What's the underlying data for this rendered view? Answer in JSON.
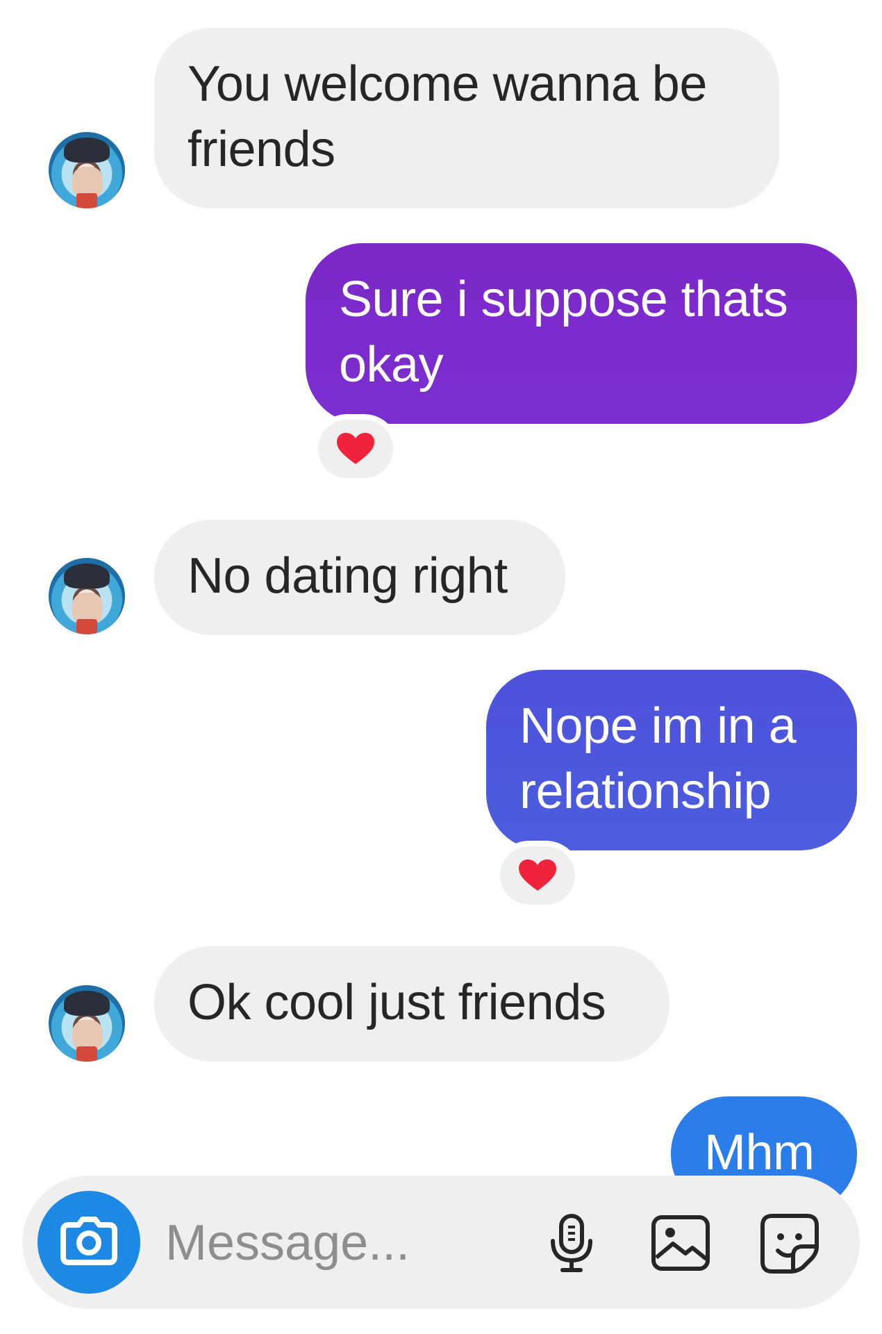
{
  "messages": [
    {
      "id": "m1",
      "direction": "incoming",
      "text": "You welcome wanna be friends"
    },
    {
      "id": "m2",
      "direction": "outgoing",
      "text": "Sure i suppose thats okay",
      "reaction": "heart"
    },
    {
      "id": "m3",
      "direction": "incoming",
      "text": "No dating right"
    },
    {
      "id": "m4",
      "direction": "outgoing",
      "text": "Nope im in a relationship",
      "reaction": "heart"
    },
    {
      "id": "m5",
      "direction": "incoming",
      "text": "Ok cool just friends"
    },
    {
      "id": "m6",
      "direction": "outgoing",
      "text": "Mhm"
    }
  ],
  "composer": {
    "placeholder": "Message...",
    "icons": [
      "camera-icon",
      "microphone-icon",
      "image-icon",
      "sticker-icon"
    ]
  },
  "colors": {
    "incoming_bg": "#efefef",
    "outgoing_purple": "#7d2ad0",
    "outgoing_indigo": "#4e5bdc",
    "outgoing_blue": "#2b7de9",
    "heart": "#ef233c",
    "camera_button": "#1e88e5"
  }
}
